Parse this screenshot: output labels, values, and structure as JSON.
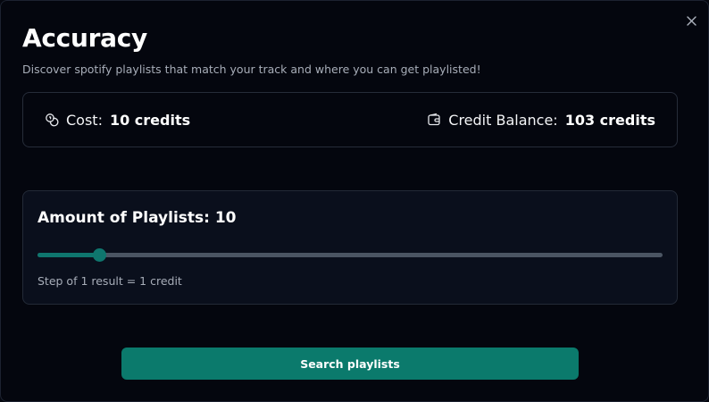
{
  "modal": {
    "title": "Accuracy",
    "subtitle": "Discover spotify playlists that match your track and where you can get playlisted!",
    "close_icon": "close-icon"
  },
  "cost": {
    "icon": "coins-icon",
    "label": "Cost:",
    "value": "10 credits"
  },
  "balance": {
    "icon": "wallet-icon",
    "label": "Credit Balance:",
    "value": "103 credits"
  },
  "amount": {
    "heading": "Amount of Playlists: 10",
    "slider_value": 10,
    "slider_min": 1,
    "slider_max": 100,
    "step_note": "Step of 1 result = 1 credit"
  },
  "actions": {
    "search_label": "Search playlists"
  },
  "colors": {
    "accent": "#0b7a6c",
    "background": "#04060e",
    "card": "#0a0f1c"
  }
}
